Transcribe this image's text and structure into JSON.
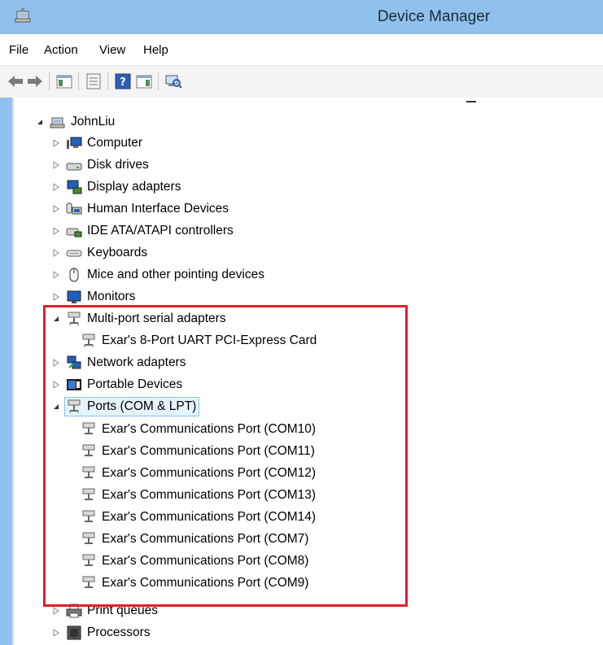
{
  "window": {
    "title": "Device Manager"
  },
  "menu": {
    "file": "File",
    "action": "Action",
    "view": "View",
    "help": "Help"
  },
  "tree": {
    "root": "JohnLiu",
    "items": [
      "Computer",
      "Disk drives",
      "Display adapters",
      "Human Interface Devices",
      "IDE ATA/ATAPI controllers",
      "Keyboards",
      "Mice and other pointing devices",
      "Monitors",
      "Multi-port serial adapters",
      "Network adapters",
      "Portable Devices",
      "Ports (COM & LPT)",
      "Print queues",
      "Processors"
    ],
    "multiport_children": [
      "Exar's 8-Port UART PCI-Express Card"
    ],
    "ports_children": [
      "Exar's Communications Port (COM10)",
      "Exar's Communications Port (COM11)",
      "Exar's Communications Port (COM12)",
      "Exar's Communications Port (COM13)",
      "Exar's Communications Port (COM14)",
      "Exar's Communications Port (COM7)",
      "Exar's Communications Port (COM8)",
      "Exar's Communications Port (COM9)"
    ]
  },
  "highlight": {
    "color": "#e0202a"
  },
  "colors": {
    "titlebar": "#8fc1ec",
    "selection": "#e5f3fb",
    "selection_border": "#84c5ea"
  }
}
